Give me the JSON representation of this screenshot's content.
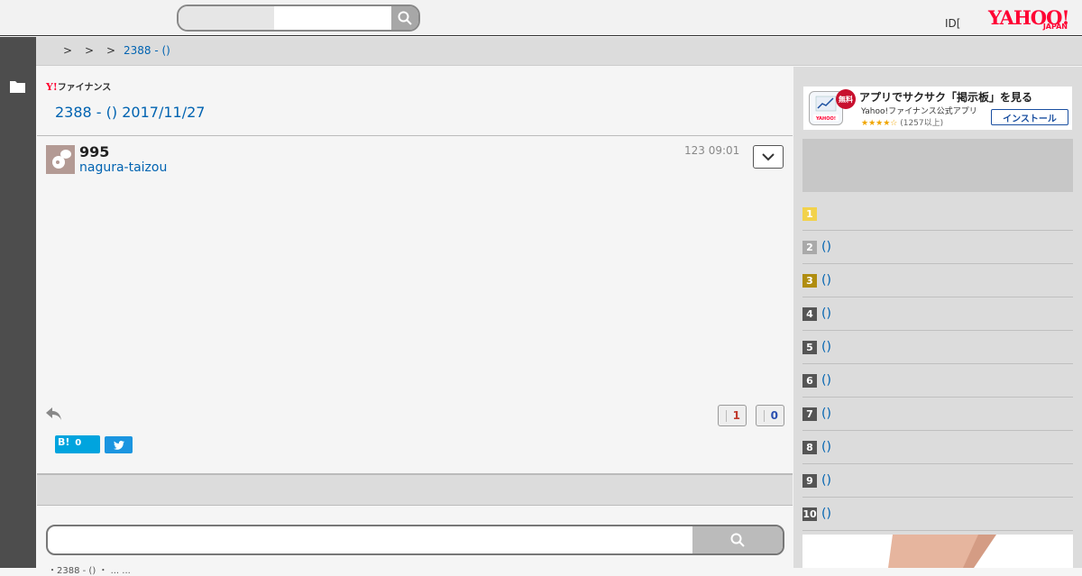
{
  "header": {
    "login_text": "ID[",
    "logo_text": "YAHOO!",
    "logo_sub": "JAPAN"
  },
  "breadcrumb": {
    "sep1": ">",
    "sep2": ">",
    "sep3": ">",
    "current": "2388 - ()"
  },
  "thread": {
    "service_logo_y": "Y!",
    "service_logo_text": "ファイナンス",
    "title": "2388 - () 2017/11/27"
  },
  "post": {
    "number": "995",
    "author": "nagura-taizou",
    "time": "123 09:01",
    "likes": "1",
    "dislikes": "0",
    "hatena_label": "B!",
    "hatena_count": "0"
  },
  "bottom": {
    "cut_text": "・2388 - ()          ・ ...   ..."
  },
  "app_promo": {
    "title": "アプリでサクサク「掲示板」を見る",
    "subtitle": "Yahoo!ファイナンス公式アプリ",
    "stars": "★★★★☆",
    "reviews": "(1257以上)",
    "badge": "無料",
    "install_label": "インストール"
  },
  "ranking": [
    {
      "rank": "1",
      "text": "",
      "color": "#f2d24b"
    },
    {
      "rank": "2",
      "text": "()",
      "color": "#a9a9a9"
    },
    {
      "rank": "3",
      "text": "()",
      "color": "#b08d10"
    },
    {
      "rank": "4",
      "text": "()",
      "color": "#555555"
    },
    {
      "rank": "5",
      "text": "()",
      "color": "#555555"
    },
    {
      "rank": "6",
      "text": "()",
      "color": "#555555"
    },
    {
      "rank": "7",
      "text": "()",
      "color": "#555555"
    },
    {
      "rank": "8",
      "text": "()",
      "color": "#555555"
    },
    {
      "rank": "9",
      "text": "()",
      "color": "#555555"
    },
    {
      "rank": "10",
      "text": "()",
      "color": "#555555"
    }
  ],
  "colors": {
    "link": "#0063b1",
    "brand_red": "#ff0033",
    "rail": "#4d4d4d"
  }
}
